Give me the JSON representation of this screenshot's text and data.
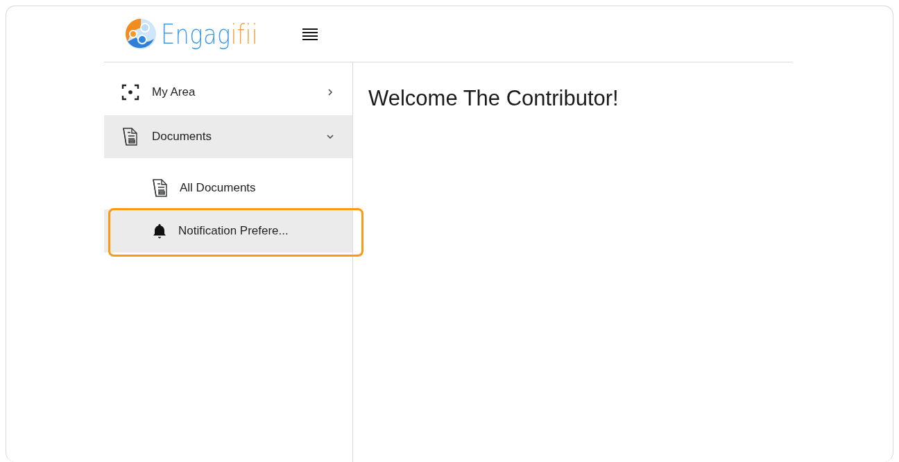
{
  "logo": {
    "text_main": "Engag",
    "text_accent": "ifii"
  },
  "sidebar": {
    "items": [
      {
        "label": "My Area",
        "kind": "focus",
        "selected": false,
        "expanded": false
      },
      {
        "label": "Documents",
        "kind": "document",
        "selected": true,
        "expanded": true,
        "children": [
          {
            "label": "All Documents",
            "kind": "document",
            "selected": false,
            "highlighted": false
          },
          {
            "label": "Notification Prefere...",
            "kind": "bell",
            "selected": true,
            "highlighted": true
          }
        ]
      }
    ]
  },
  "main": {
    "heading": "Welcome The Contributor!"
  }
}
